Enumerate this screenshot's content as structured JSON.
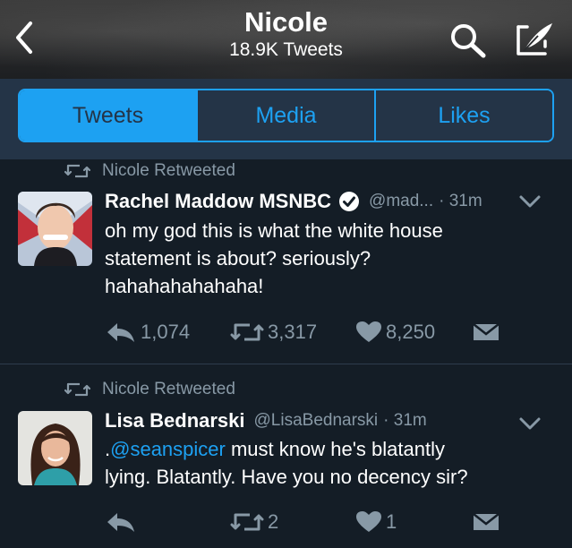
{
  "header": {
    "title": "Nicole",
    "subtitle": "18.9K Tweets",
    "icons": [
      "back-chevron-icon",
      "search-icon",
      "compose-icon"
    ]
  },
  "tabs": [
    {
      "label": "Tweets",
      "active": true
    },
    {
      "label": "Media",
      "active": false
    },
    {
      "label": "Likes",
      "active": false
    }
  ],
  "tweets": [
    {
      "retweeted_by": "Nicole Retweeted",
      "name": "Rachel Maddow MSNBC",
      "verified": true,
      "handle": "@mad...",
      "time": "· 31m",
      "text_parts": [
        "oh my god this is what the white house",
        "statement is about? seriously?",
        "hahahahahahaha!"
      ],
      "replies": "1,074",
      "retweets": "3,317",
      "likes": "8,250"
    },
    {
      "retweeted_by": "Nicole Retweeted",
      "name": "Lisa Bednarski",
      "verified": false,
      "handle": "@LisaBednarski",
      "time": "· 31m",
      "mention": "@seanspicer",
      "text_prefix": ".",
      "text_after_mention": " must know he's blatantly",
      "text_line2": "lying. Blatantly. Have you no decency sir?",
      "replies": "",
      "retweets": "2",
      "likes": "1"
    }
  ],
  "colors": {
    "background": "#141d26",
    "tab_bar": "#243447",
    "accent": "#1da1f2",
    "muted": "#8899a6"
  }
}
